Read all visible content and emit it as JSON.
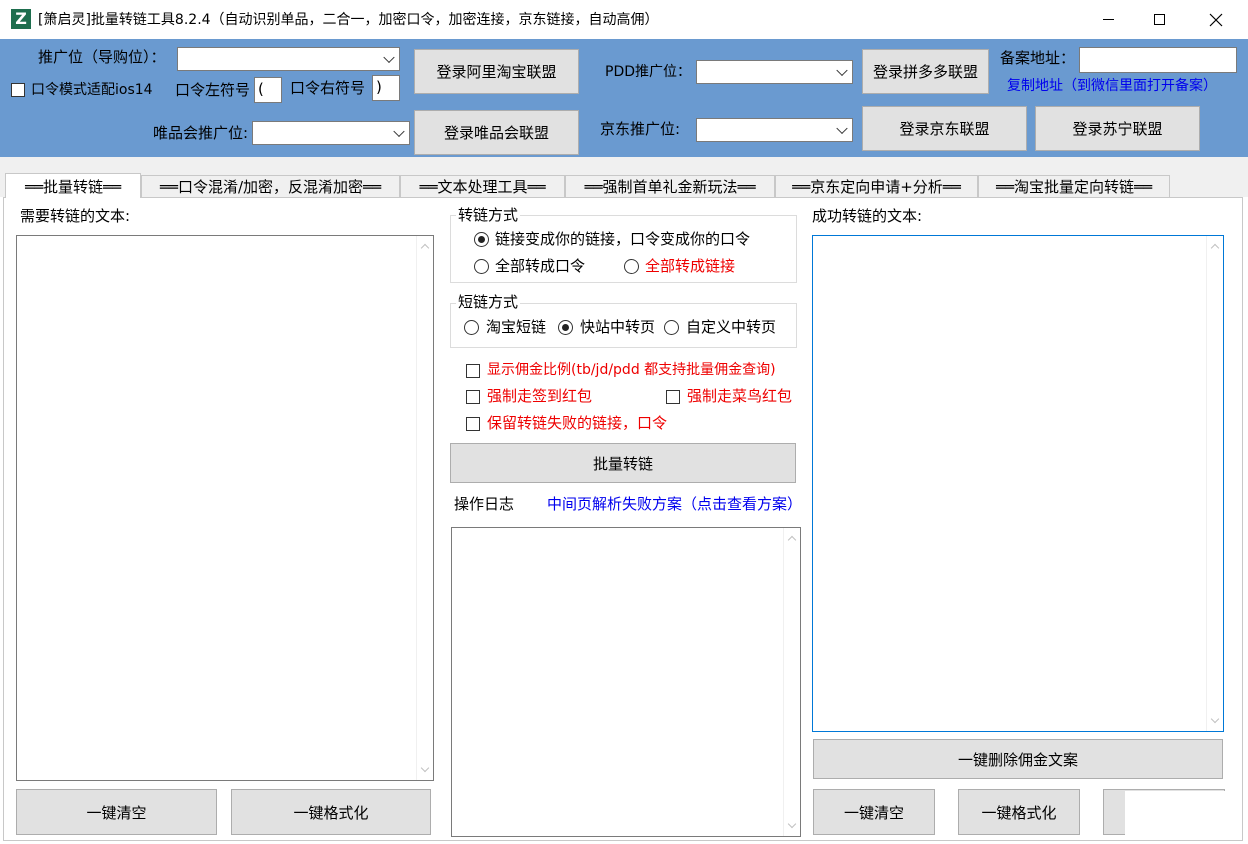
{
  "window": {
    "title": "[箫启灵]批量转链工具8.2.4（自动识别单品，二合一，加密口令，加密连接，京东链接，自动高佣）",
    "app_icon_letter": "Z",
    "minimize_glyph": "—",
    "maximize_glyph": "☐",
    "close_glyph": "✕"
  },
  "header": {
    "tuiguang_label": "推广位（导购位）：",
    "tuiguang_value": "",
    "login_taobao_label": "登录阿里淘宝联盟",
    "pdd_label": "PDD推广位：",
    "pdd_value": "",
    "login_pdd_label": "登录拼多多联盟",
    "beian_label": "备案地址：",
    "beian_value": "",
    "copy_address_label": "复制地址（到微信里面打开备案）",
    "ios14_label": "口令模式适配ios14",
    "left_symbol_label": "口令左符号",
    "left_symbol_value": "(",
    "right_symbol_label": "口令右符号",
    "right_symbol_value": ")",
    "vip_label": "唯品会推广位:",
    "vip_value": "",
    "login_vip_label": "登录唯品会联盟",
    "jd_label": "京东推广位:",
    "jd_value": "",
    "login_jd_label": "登录京东联盟",
    "login_suning_label": "登录苏宁联盟"
  },
  "tabs": [
    "══批量转链══",
    "══口令混淆/加密，反混淆加密══",
    "══文本处理工具══",
    "══强制首单礼金新玩法══",
    "══京东定向申请+分析══",
    "══淘宝批量定向转链══"
  ],
  "left": {
    "input_label": "需要转链的文本:",
    "input_value": "",
    "clear_label": "一键清空",
    "format_label": "一键格式化"
  },
  "middle": {
    "convert_group_title": "转链方式",
    "convert_options": [
      "链接变成你的链接，口令变成你的口令",
      "全部转成口令",
      "全部转成链接"
    ],
    "short_group_title": "短链方式",
    "short_options": [
      "淘宝短链",
      "快站中转页",
      "自定义中转页"
    ],
    "checks": [
      "显示佣金比例(tb/jd/pdd 都支持批量佣金查询)",
      "强制走签到红包",
      "强制走菜鸟红包",
      "保留转链失败的链接，口令"
    ],
    "batch_button_label": "批量转链",
    "log_label": "操作日志",
    "log_link_label": "中间页解析失败方案（点击查看方案）",
    "log_value": ""
  },
  "right": {
    "output_label": "成功转链的文本:",
    "output_value": "",
    "delete_commission_label": "一键删除佣金文案",
    "clear_label": "一键清空",
    "format_label": "一键格式化"
  },
  "colors": {
    "header_bg": "#6a9ad0",
    "accent_red": "#ee0000",
    "accent_blue": "#0000ee",
    "app_icon_bg": "#1e6e4e"
  }
}
